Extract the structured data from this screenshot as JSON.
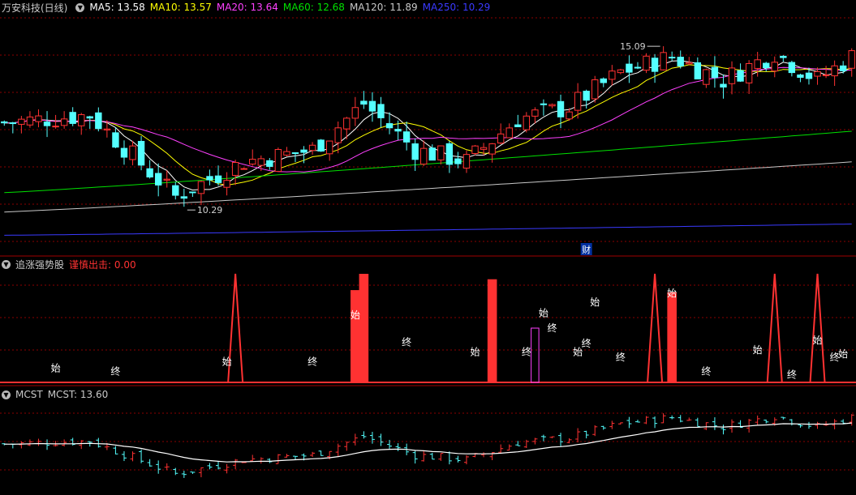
{
  "main_panel": {
    "title": "万安科技(日线)",
    "toggle_icon": "chevron-down-icon",
    "ma_labels": [
      {
        "label": "MA5: 13.58",
        "color": "#ffffff"
      },
      {
        "label": "MA10: 13.57",
        "color": "#ffff00"
      },
      {
        "label": "MA20: 13.64",
        "color": "#ff40ff"
      },
      {
        "label": "MA60: 12.68",
        "color": "#00e000"
      },
      {
        "label": "MA120: 11.89",
        "color": "#c8c8c8"
      },
      {
        "label": "MA250: 10.29",
        "color": "#3a3aff"
      }
    ],
    "high_marker": "15.09",
    "low_marker": "10.29",
    "event_badge": "财"
  },
  "indicator_panel": {
    "name": "追涨强势股",
    "toggle_icon": "chevron-down-icon",
    "signal_label": "谨慎出击: 0.00",
    "marker_start": "始",
    "marker_end": "终"
  },
  "mcst_panel": {
    "name": "MCST",
    "toggle_icon": "chevron-down-icon",
    "value_label": "MCST: 13.60"
  },
  "colors": {
    "up": "#ff3232",
    "down": "#54ffff",
    "grid": "#8b0000",
    "separator": "#a00000"
  },
  "chart_data": [
    {
      "type": "candlestick",
      "title": "万安科技(日线)",
      "ylim": [
        9.8,
        15.6
      ],
      "count": 100,
      "series": [
        {
          "name": "MA5",
          "value": 13.58
        },
        {
          "name": "MA10",
          "value": 13.57
        },
        {
          "name": "MA20",
          "value": 13.64
        },
        {
          "name": "MA60",
          "value": 12.68
        },
        {
          "name": "MA120",
          "value": 11.89
        },
        {
          "name": "MA250",
          "value": 10.29
        }
      ],
      "annotations": [
        {
          "text": "15.09",
          "type": "high"
        },
        {
          "text": "10.29",
          "type": "low"
        },
        {
          "text": "财",
          "type": "event"
        }
      ]
    },
    {
      "type": "bar",
      "title": "追涨强势股",
      "value": 0.0,
      "signals": [
        {
          "index": 27,
          "kind": "spike"
        },
        {
          "index": 41,
          "kind": "bar",
          "value": 0.85
        },
        {
          "index": 42,
          "kind": "bar",
          "value": 1.0
        },
        {
          "index": 57,
          "kind": "bar",
          "value": 0.95
        },
        {
          "index": 62,
          "kind": "outline",
          "value": 0.5
        },
        {
          "index": 76,
          "kind": "spike"
        },
        {
          "index": 78,
          "kind": "bar",
          "value": 0.83
        },
        {
          "index": 90,
          "kind": "spike"
        },
        {
          "index": 95,
          "kind": "spike"
        }
      ],
      "markers": [
        {
          "index": 6,
          "text": "始",
          "level": 0.07
        },
        {
          "index": 13,
          "text": "终",
          "level": 0.04
        },
        {
          "index": 26,
          "text": "始",
          "level": 0.13
        },
        {
          "index": 36,
          "text": "终",
          "level": 0.13
        },
        {
          "index": 41,
          "text": "始",
          "level": 0.56
        },
        {
          "index": 47,
          "text": "终",
          "level": 0.31
        },
        {
          "index": 55,
          "text": "始",
          "level": 0.22
        },
        {
          "index": 61,
          "text": "终",
          "level": 0.22
        },
        {
          "index": 63,
          "text": "始",
          "level": 0.58
        },
        {
          "index": 64,
          "text": "终",
          "level": 0.44
        },
        {
          "index": 67,
          "text": "始",
          "level": 0.22
        },
        {
          "index": 68,
          "text": "终",
          "level": 0.3
        },
        {
          "index": 69,
          "text": "始",
          "level": 0.68
        },
        {
          "index": 72,
          "text": "终",
          "level": 0.17
        },
        {
          "index": 78,
          "text": "始",
          "level": 0.76
        },
        {
          "index": 82,
          "text": "终",
          "level": 0.04
        },
        {
          "index": 88,
          "text": "始",
          "level": 0.24
        },
        {
          "index": 92,
          "text": "终",
          "level": 0.01
        },
        {
          "index": 95,
          "text": "始",
          "level": 0.33
        },
        {
          "index": 97,
          "text": "终",
          "level": 0.17
        },
        {
          "index": 98,
          "text": "始",
          "level": 0.2
        }
      ]
    },
    {
      "type": "line",
      "title": "MCST",
      "value": 13.6
    }
  ]
}
